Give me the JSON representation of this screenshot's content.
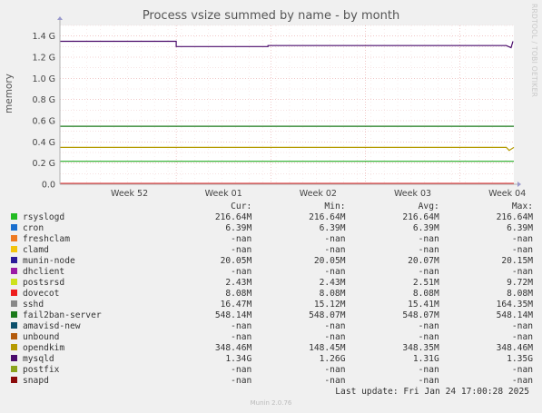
{
  "chart_data": {
    "type": "line",
    "title": "Process vsize summed by name - by month",
    "ylabel": "memory",
    "ylim": [
      0,
      1.5
    ],
    "y_unit": "G",
    "yticks": [
      "0.0",
      "0.2 G",
      "0.4 G",
      "0.6 G",
      "0.8 G",
      "1.0 G",
      "1.2 G",
      "1.4 G"
    ],
    "ytick_values": [
      0,
      0.2,
      0.4,
      0.6,
      0.8,
      1.0,
      1.2,
      1.4
    ],
    "x_categories": [
      "Week 52",
      "Week 01",
      "Week 02",
      "Week 03",
      "Week 04"
    ],
    "grid": true,
    "series": [
      {
        "name": "mysqld",
        "color": "#4a0b6b",
        "points": [
          [
            0,
            1.35
          ],
          [
            1.23,
            1.35
          ],
          [
            1.23,
            1.3
          ],
          [
            2.2,
            1.3
          ],
          [
            2.2,
            1.31
          ],
          [
            4.72,
            1.31
          ],
          [
            4.77,
            1.29
          ],
          [
            4.79,
            1.35
          ]
        ]
      },
      {
        "name": "fail2ban-server",
        "color": "#1a7a1a",
        "points": [
          [
            0,
            0.548
          ],
          [
            4.8,
            0.548
          ]
        ]
      },
      {
        "name": "opendkim",
        "color": "#b59a00",
        "points": [
          [
            0,
            0.348
          ],
          [
            4.72,
            0.348
          ],
          [
            4.75,
            0.32
          ],
          [
            4.8,
            0.348
          ]
        ]
      },
      {
        "name": "rsyslogd",
        "color": "#22aa22",
        "points": [
          [
            0,
            0.217
          ],
          [
            4.8,
            0.217
          ]
        ]
      },
      {
        "name": "dovecot",
        "color": "#dd2020",
        "points": [
          [
            0,
            0.008
          ],
          [
            4.8,
            0.008
          ]
        ]
      }
    ],
    "legend_headers": [
      "Cur:",
      "Min:",
      "Avg:",
      "Max:"
    ],
    "legend": [
      {
        "name": "rsyslogd",
        "color": "#22bb22",
        "cur": "216.64M",
        "min": "216.64M",
        "avg": "216.64M",
        "max": "216.64M"
      },
      {
        "name": "cron",
        "color": "#1a6fce",
        "cur": "6.39M",
        "min": "6.39M",
        "avg": "6.39M",
        "max": "6.39M"
      },
      {
        "name": "freshclam",
        "color": "#ee7a22",
        "cur": "-nan",
        "min": "-nan",
        "avg": "-nan",
        "max": "-nan"
      },
      {
        "name": "clamd",
        "color": "#f2c40c",
        "cur": "-nan",
        "min": "-nan",
        "avg": "-nan",
        "max": "-nan"
      },
      {
        "name": "munin-node",
        "color": "#2b1a99",
        "cur": "20.05M",
        "min": "20.05M",
        "avg": "20.07M",
        "max": "20.15M"
      },
      {
        "name": "dhclient",
        "color": "#9b1ba6",
        "cur": "-nan",
        "min": "-nan",
        "avg": "-nan",
        "max": "-nan"
      },
      {
        "name": "postsrsd",
        "color": "#cde21e",
        "cur": "2.43M",
        "min": "2.43M",
        "avg": "2.51M",
        "max": "9.72M"
      },
      {
        "name": "dovecot",
        "color": "#ee1e1e",
        "cur": "8.08M",
        "min": "8.08M",
        "avg": "8.08M",
        "max": "8.08M"
      },
      {
        "name": "sshd",
        "color": "#888888",
        "cur": "16.47M",
        "min": "15.12M",
        "avg": "15.41M",
        "max": "164.35M"
      },
      {
        "name": "fail2ban-server",
        "color": "#1a7a1a",
        "cur": "548.14M",
        "min": "548.07M",
        "avg": "548.07M",
        "max": "548.14M"
      },
      {
        "name": "amavisd-new",
        "color": "#0b4f6b",
        "cur": "-nan",
        "min": "-nan",
        "avg": "-nan",
        "max": "-nan"
      },
      {
        "name": "unbound",
        "color": "#b35a0b",
        "cur": "-nan",
        "min": "-nan",
        "avg": "-nan",
        "max": "-nan"
      },
      {
        "name": "opendkim",
        "color": "#b59a00",
        "cur": "348.46M",
        "min": "148.45M",
        "avg": "348.35M",
        "max": "348.46M"
      },
      {
        "name": "mysqld",
        "color": "#4a0b6b",
        "cur": "1.34G",
        "min": "1.26G",
        "avg": "1.31G",
        "max": "1.35G"
      },
      {
        "name": "postfix",
        "color": "#8aa31e",
        "cur": "-nan",
        "min": "-nan",
        "avg": "-nan",
        "max": "-nan"
      },
      {
        "name": "snapd",
        "color": "#8b0b0b",
        "cur": "-nan",
        "min": "-nan",
        "avg": "-nan",
        "max": "-nan"
      }
    ]
  },
  "last_update": "Last update: Fri Jan 24 17:00:28 2025",
  "side_label": "RRDTOOL / TOBI OETIKER",
  "footer": "Munin 2.0.76"
}
